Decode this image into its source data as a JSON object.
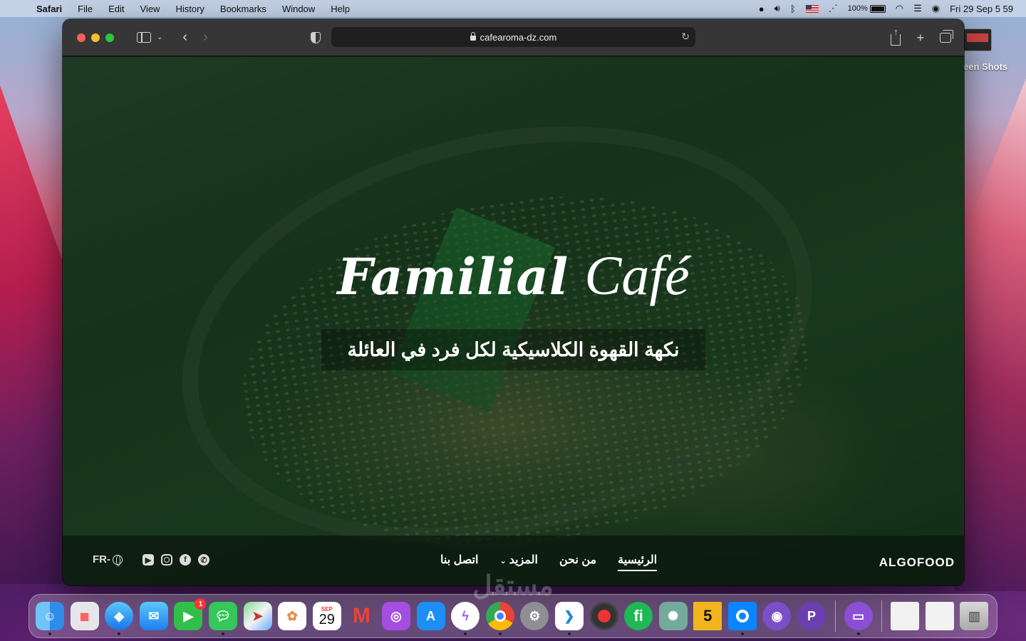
{
  "menubar": {
    "app_name": "Safari",
    "items": [
      "File",
      "Edit",
      "View",
      "History",
      "Bookmarks",
      "Window",
      "Help"
    ],
    "battery_percent": "100%",
    "datetime": "Fri 29 Sep  5 59"
  },
  "desktop": {
    "folder_label": "een Shots"
  },
  "browser": {
    "url": "cafearoma-dz.com"
  },
  "site": {
    "hero_title_part1": "Familial",
    "hero_title_part2": "Café",
    "tagline": "نكهة القهوة الكلاسيكية لكل فرد في العائلة",
    "nav": {
      "home": "الرئيسية",
      "about": "من نحن",
      "more": "المزيد",
      "contact": "اتصل بنا"
    },
    "language": "FR-",
    "brand": "ALGOFOOD"
  },
  "watermark": "مستقل",
  "dock": {
    "calendar_month": "SEP",
    "calendar_day": "29",
    "facetime_badge": "1"
  }
}
